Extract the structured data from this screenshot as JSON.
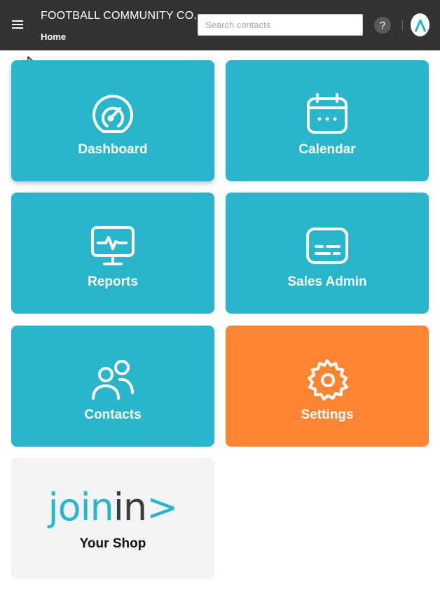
{
  "header": {
    "organization": "FOOTBALL COMMUNITY CO.",
    "breadcrumb": "Home",
    "search_placeholder": "Search contacts",
    "help_label": "?",
    "menu_icon": "hamburger-menu-icon",
    "avatar_icon": "brand-logo-icon"
  },
  "tiles": [
    {
      "label": "Dashboard",
      "icon": "speedometer-icon",
      "color": "#29b6cc"
    },
    {
      "label": "Calendar",
      "icon": "calendar-icon",
      "color": "#29b6cc"
    },
    {
      "label": "Reports",
      "icon": "monitor-pulse-icon",
      "color": "#29b6cc"
    },
    {
      "label": "Sales Admin",
      "icon": "card-icon",
      "color": "#29b6cc"
    },
    {
      "label": "Contacts",
      "icon": "users-icon",
      "color": "#29b6cc"
    },
    {
      "label": "Settings",
      "icon": "gear-icon",
      "color": "#ff8533"
    },
    {
      "label": "Your Shop",
      "icon": "joinin-logo",
      "color": "#f2f3f5",
      "logo_text": {
        "part1": "join",
        "part2": "in",
        "part3": ">"
      }
    }
  ],
  "colors": {
    "topbar": "#333333",
    "tile_teal": "#29b6cc",
    "tile_orange": "#ff8533",
    "tile_grey": "#f2f3f5"
  }
}
